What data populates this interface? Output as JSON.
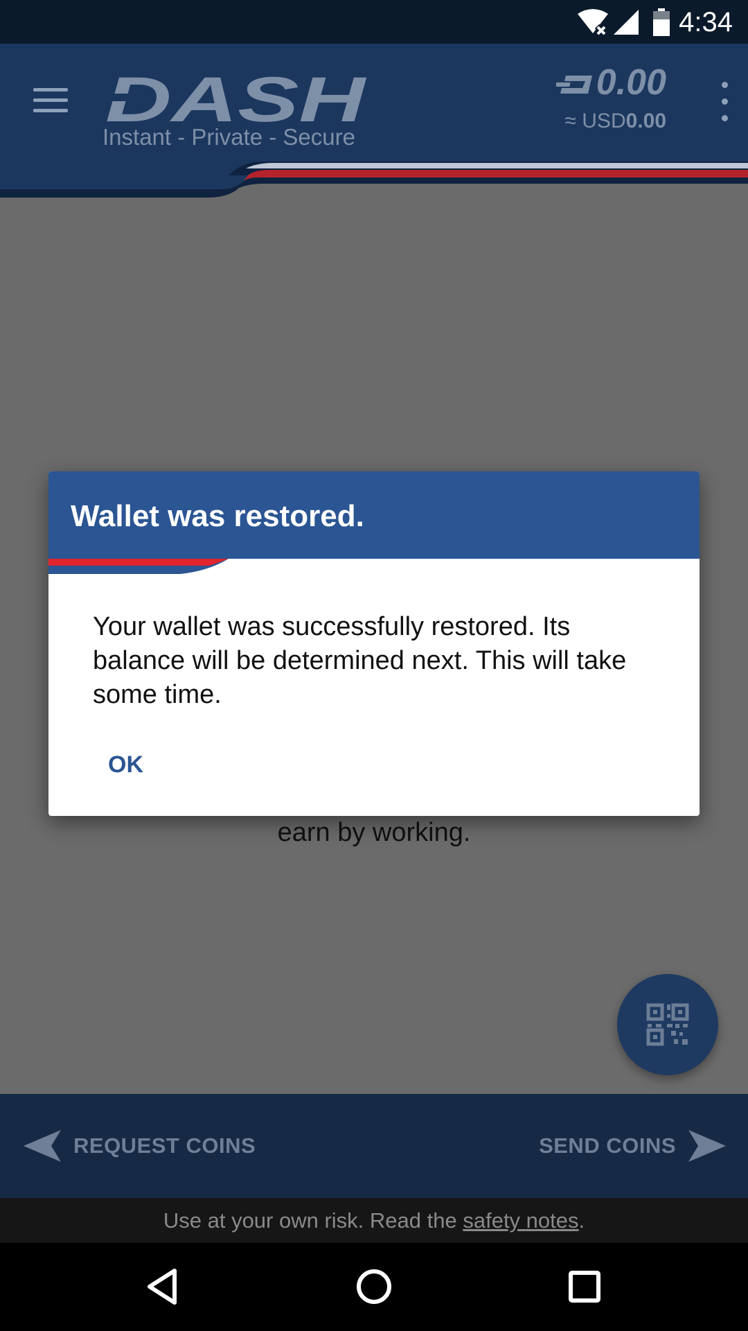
{
  "status_bar": {
    "time": "4:34",
    "icons": [
      "wifi-off-icon",
      "signal-icon",
      "battery-icon"
    ]
  },
  "app_bar": {
    "menu_icon": "hamburger-menu-icon",
    "logo_text": "DASH",
    "tagline": "Instant - Private - Secure",
    "balance": "0.00",
    "fiat_prefix": "≈ USD",
    "fiat_value": "0.00",
    "overflow_icon": "more-vert-icon"
  },
  "content": {
    "background_text": "earn by working."
  },
  "fab": {
    "icon": "qr-code-scan-icon"
  },
  "action_bar": {
    "request_label": "REQUEST COINS",
    "send_label": "SEND COINS"
  },
  "disclaimer": {
    "prefix": "Use at your own risk. Read the ",
    "link": "safety notes",
    "suffix": "."
  },
  "dialog": {
    "title": "Wallet was restored.",
    "message": "Your wallet was successfully restored. Its balance will be determined next. This will take some time.",
    "ok_label": "OK"
  },
  "nav_bar": {
    "icons": [
      "back-icon",
      "home-icon",
      "recents-icon"
    ]
  },
  "colors": {
    "brand_blue": "#2b5593",
    "header_blue": "#1c375e",
    "accent_red": "#e0252f"
  }
}
